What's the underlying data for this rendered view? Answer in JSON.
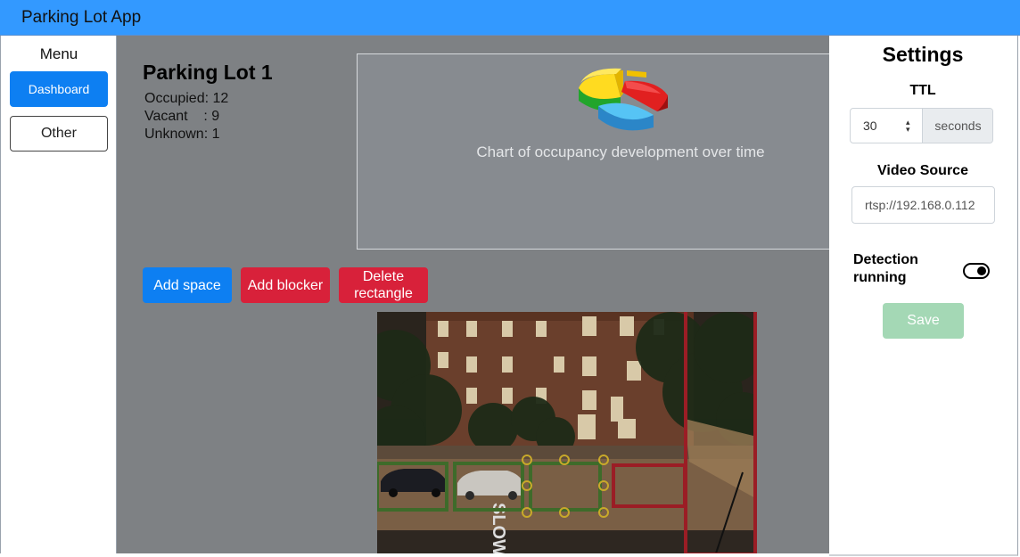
{
  "app": {
    "title": "Parking Lot App"
  },
  "sidebar": {
    "menu_label": "Menu",
    "items": [
      {
        "label": "Dashboard"
      },
      {
        "label": "Other"
      }
    ]
  },
  "lot": {
    "title": "Parking Lot 1",
    "stats": [
      "Occupied: 12",
      "Vacant    : 9",
      "Unknown: 1"
    ]
  },
  "chart": {
    "icon": "pie-chart-icon",
    "caption": "Chart of occupancy development over time"
  },
  "actions": {
    "add_space": "Add space",
    "add_blocker": "Add blocker",
    "delete_rectangle": "Delete rectangle"
  },
  "camera": {
    "street_marking": "SLOW"
  },
  "settings": {
    "title": "Settings",
    "ttl_label": "TTL",
    "ttl_value": "30",
    "ttl_unit": "seconds",
    "video_source_label": "Video Source",
    "video_source_value": "rtsp://192.168.0.112",
    "detection_label": "Detection running",
    "detection_on": true,
    "save_label": "Save"
  },
  "colors": {
    "topbar": "#3399ff",
    "primary": "#0d7ff2",
    "danger": "#d8213a",
    "save_disabled": "#a4d8b5",
    "space_rect": "#3e6b2a",
    "blocker_rect": "#9b1d25"
  }
}
